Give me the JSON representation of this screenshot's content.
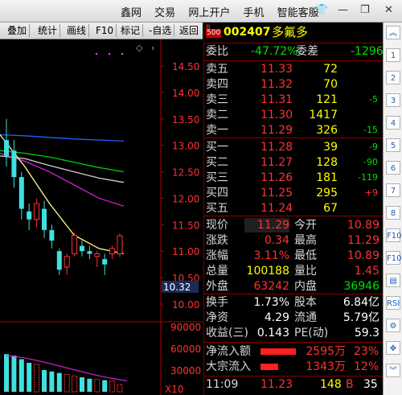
{
  "topbar": {
    "menu": [
      "鑫网",
      "交易",
      "网上开户",
      "手机",
      "智能客服"
    ],
    "icons": [
      "shirt-icon",
      "minimize-icon",
      "restore-icon",
      "close-icon"
    ]
  },
  "toolbar": {
    "items": [
      "叠加",
      "统计",
      "画线",
      "F10",
      "标记",
      "-自选",
      "返回"
    ]
  },
  "chart": {
    "price_ticks": [
      "14.50",
      "14.00",
      "13.50",
      "13.00",
      "12.50",
      "12.00",
      "11.50",
      "11.00",
      "10.50",
      "10.00"
    ],
    "vol_ticks": [
      "90000",
      "60000",
      "30000"
    ],
    "vol_unit": "X10",
    "current_price_label": "10.32"
  },
  "chart_data": {
    "type": "candlestick",
    "candles": [
      {
        "o": 13.1,
        "c": 12.8,
        "h": 13.5,
        "l": 12.6
      },
      {
        "o": 12.9,
        "c": 12.4,
        "h": 13.1,
        "l": 12.2
      },
      {
        "o": 12.4,
        "c": 11.8,
        "h": 12.5,
        "l": 11.6
      },
      {
        "o": 11.75,
        "c": 11.6,
        "h": 11.9,
        "l": 11.4
      },
      {
        "o": 11.6,
        "c": 11.9,
        "h": 12.0,
        "l": 11.45
      },
      {
        "o": 11.8,
        "c": 11.4,
        "h": 11.95,
        "l": 11.25
      },
      {
        "o": 11.4,
        "c": 11.2,
        "h": 11.5,
        "l": 11.05
      },
      {
        "o": 11.0,
        "c": 10.65,
        "h": 11.05,
        "l": 10.55
      },
      {
        "o": 10.7,
        "c": 10.9,
        "h": 10.95,
        "l": 10.55
      },
      {
        "o": 10.95,
        "c": 11.3,
        "h": 11.35,
        "l": 10.9
      },
      {
        "o": 11.1,
        "c": 11.0,
        "h": 11.2,
        "l": 10.9
      },
      {
        "o": 11.0,
        "c": 10.95,
        "h": 11.1,
        "l": 10.85
      },
      {
        "o": 10.9,
        "c": 10.95,
        "h": 11.0,
        "l": 10.7
      },
      {
        "o": 10.85,
        "c": 10.75,
        "h": 10.95,
        "l": 10.55
      },
      {
        "o": 10.95,
        "c": 11.05,
        "h": 11.1,
        "l": 10.85
      },
      {
        "o": 10.95,
        "c": 11.29,
        "h": 11.33,
        "l": 10.89
      }
    ],
    "volumes": [
      52000,
      50000,
      45000,
      40000,
      38000,
      30000,
      28000,
      26000,
      24000,
      22000,
      20000,
      18000,
      17000,
      16000,
      15000,
      10018
    ],
    "ma_lines": [
      {
        "color": "#2060ff",
        "y": [
          13.2,
          13.18,
          13.15,
          13.12,
          13.1,
          13.08
        ]
      },
      {
        "color": "#00d000",
        "y": [
          12.9,
          12.85,
          12.78,
          12.68,
          12.58,
          12.5
        ]
      },
      {
        "color": "#cfcfcf",
        "y": [
          12.8,
          12.75,
          12.62,
          12.5,
          12.38,
          12.3
        ]
      },
      {
        "color": "#d020d0",
        "y": [
          12.85,
          12.7,
          12.5,
          12.25,
          12.0,
          11.85
        ]
      },
      {
        "color": "#ffff80",
        "y": [
          13.2,
          12.6,
          11.9,
          11.3,
          11.05,
          10.95
        ]
      }
    ],
    "vol_ma": {
      "color": "#d020d0",
      "y": [
        50000,
        47000,
        42000,
        36000,
        30000,
        24000,
        19000,
        15000
      ]
    },
    "price_range": [
      10.0,
      14.5
    ],
    "vol_range": [
      0,
      90000
    ]
  },
  "stock": {
    "tag": "R",
    "tag_num": "500",
    "code": "002407",
    "name": "多氟多"
  },
  "ratio": {
    "wb_label": "委比",
    "wb_value": "-47.72%",
    "wc_label": "委差",
    "wc_value": "-1296"
  },
  "asks": [
    {
      "label": "卖五",
      "price": "11.33",
      "vol": "72",
      "chg": ""
    },
    {
      "label": "卖四",
      "price": "11.32",
      "vol": "70",
      "chg": ""
    },
    {
      "label": "卖三",
      "price": "11.31",
      "vol": "121",
      "chg": "-5"
    },
    {
      "label": "卖二",
      "price": "11.30",
      "vol": "1417",
      "chg": ""
    },
    {
      "label": "卖一",
      "price": "11.29",
      "vol": "326",
      "chg": "-15"
    }
  ],
  "bids": [
    {
      "label": "买一",
      "price": "11.28",
      "vol": "39",
      "chg": "-9"
    },
    {
      "label": "买二",
      "price": "11.27",
      "vol": "128",
      "chg": "-90"
    },
    {
      "label": "买三",
      "price": "11.26",
      "vol": "181",
      "chg": "-119"
    },
    {
      "label": "买四",
      "price": "11.25",
      "vol": "295",
      "chg": "+9"
    },
    {
      "label": "买五",
      "price": "11.24",
      "vol": "67",
      "chg": ""
    }
  ],
  "stats": [
    {
      "l1": "现价",
      "v1": "11.29",
      "l2": "今开",
      "v2": "10.89"
    },
    {
      "l1": "涨跌",
      "v1": "0.34",
      "l2": "最高",
      "v2": "11.29"
    },
    {
      "l1": "涨幅",
      "v1": "3.11%",
      "l2": "最低",
      "v2": "10.89"
    },
    {
      "l1": "总量",
      "v1": "100188",
      "l2": "量比",
      "v2": "1.45"
    },
    {
      "l1": "外盘",
      "v1": "63242",
      "l2": "内盘",
      "v2": "36946"
    }
  ],
  "stats2": [
    {
      "l1": "换手",
      "v1": "1.73%",
      "l2": "股本",
      "v2": "6.84亿"
    },
    {
      "l1": "净资",
      "v1": "4.29",
      "l2": "流通",
      "v2": "5.79亿"
    },
    {
      "l1": "收益(三)",
      "v1": "0.143",
      "l2": "PE(动)",
      "v2": "59.3"
    }
  ],
  "flows": [
    {
      "label": "净流入额",
      "amount": "2595万",
      "pct": "23%"
    },
    {
      "label": "大宗流入",
      "amount": "1343万",
      "pct": "12%"
    }
  ],
  "tick": {
    "time": "11:09",
    "price": "11.23",
    "vol": "148",
    "side": "B",
    "count": "35"
  },
  "right_icons": [
    "chevron-up-icon",
    "chart-icon",
    "trend-icon",
    "num1-icon",
    "num2-icon",
    "num3-icon",
    "list-icon",
    "grid-icon",
    "kline-icon",
    "f10-icon",
    "fin-icon",
    "table-icon",
    "rsi-icon",
    "gear-icon",
    "move-icon",
    "chevron-down-icon"
  ],
  "right_icon_text": [
    "︽",
    "1",
    "2",
    "3",
    "4",
    "5",
    "6",
    "7",
    "8",
    "F10",
    "F10",
    "▤",
    "RSI",
    "⚙",
    "✥",
    "︾"
  ]
}
